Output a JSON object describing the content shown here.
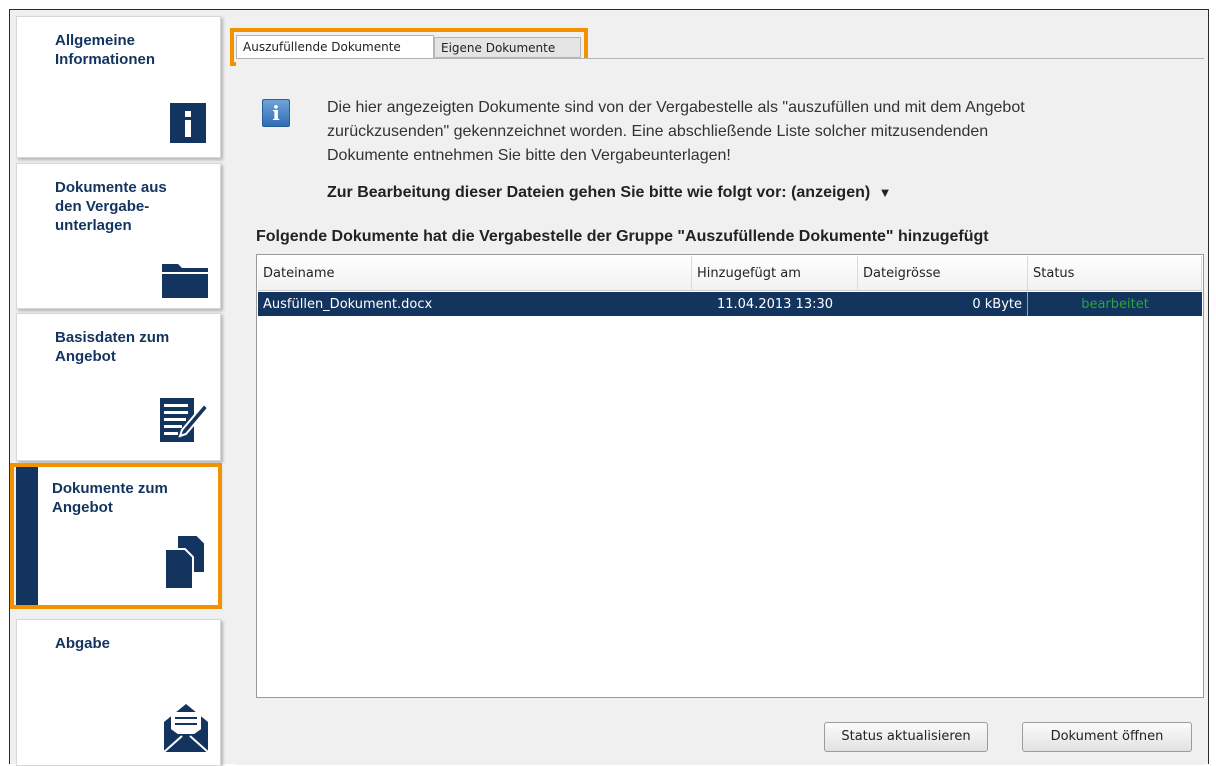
{
  "sidebar": {
    "items": [
      {
        "label_line1": "Allgemeine",
        "label_line2": "Informationen",
        "icon": "info-icon"
      },
      {
        "label_line1": "Dokumente aus",
        "label_line2": "den Vergabe-",
        "label_line3": "unterlagen",
        "icon": "folder-icon"
      },
      {
        "label_line1": "Basisdaten zum",
        "label_line2": "Angebot",
        "icon": "edit-document-icon"
      },
      {
        "label_line1": "Dokumente zum",
        "label_line2": "Angebot",
        "icon": "documents-icon",
        "active": true
      },
      {
        "label_line1": "Abgabe",
        "icon": "envelope-icon"
      }
    ]
  },
  "tabs": {
    "active": "Auszufüllende Dokumente",
    "inactive": "Eigene Dokumente"
  },
  "info": {
    "icon": "info-icon",
    "line1": "Die hier angezeigten Dokumente sind von der Vergabestelle als \"auszufüllen und mit dem Angebot",
    "line2": "zurückzusenden\" gekennzeichnet worden. Eine abschließende Liste solcher mitzusendenden",
    "line3": "Dokumente entnehmen Sie bitte den Vergabeunterlagen!",
    "instructions": "Zur Bearbeitung dieser Dateien gehen Sie bitte wie folgt vor: (anzeigen)",
    "instructions_arrow": "▼"
  },
  "section_heading": "Folgende Dokumente hat die Vergabestelle der Gruppe \"Auszufüllende Dokumente\" hinzugefügt",
  "table": {
    "columns": [
      "Dateiname",
      "Hinzugefügt am",
      "Dateigrösse",
      "Status"
    ],
    "rows": [
      {
        "name": "Ausfüllen_Dokument.docx",
        "date": "11.04.2013 13:30",
        "size": "0 kByte",
        "status": "bearbeitet"
      }
    ]
  },
  "buttons": {
    "refresh": "Status aktualisieren",
    "open": "Dokument öffnen"
  },
  "colors": {
    "nav": "#13345f",
    "highlight": "#f39200",
    "status_ok": "#29a637"
  }
}
